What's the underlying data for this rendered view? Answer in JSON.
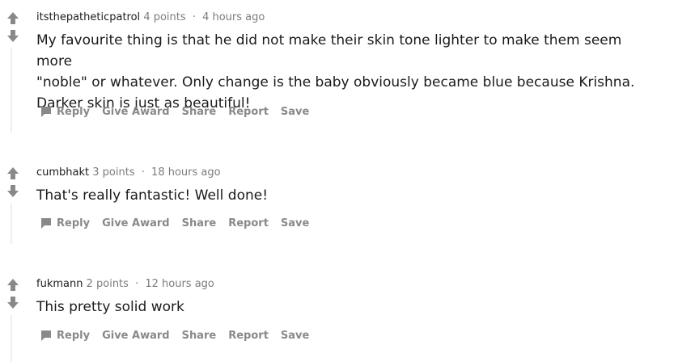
{
  "comments": [
    {
      "author": "itsthepatheticpatrol",
      "points": "4 points",
      "time": "4 hours ago",
      "body_lines": [
        "My favourite thing is that he did not make their skin tone lighter to make them seem more",
        "\"noble\" or whatever. Only change is the baby obviously became blue because Krishna.",
        "Darker skin is just as beautiful!"
      ]
    },
    {
      "author": "cumbhakt",
      "points": "3 points",
      "time": "18 hours ago",
      "body_lines": [
        "That's really fantastic! Well done!"
      ]
    },
    {
      "author": "fukmann",
      "points": "2 points",
      "time": "12 hours ago",
      "body_lines": [
        "This pretty solid work"
      ]
    }
  ],
  "actions": {
    "reply": "Reply",
    "give_award": "Give Award",
    "share": "Share",
    "report": "Report",
    "save": "Save"
  },
  "meta_separator": "·",
  "icons": {
    "upvote": "upvote-arrow-icon",
    "downvote": "downvote-arrow-icon",
    "reply": "speech-bubble-icon"
  },
  "colors": {
    "vote_arrow": "#878a8c",
    "meta_text": "#7c7c7c",
    "body_text": "#1a1a1b",
    "action_text": "#878a8c",
    "thread_line": "#edeff1"
  }
}
